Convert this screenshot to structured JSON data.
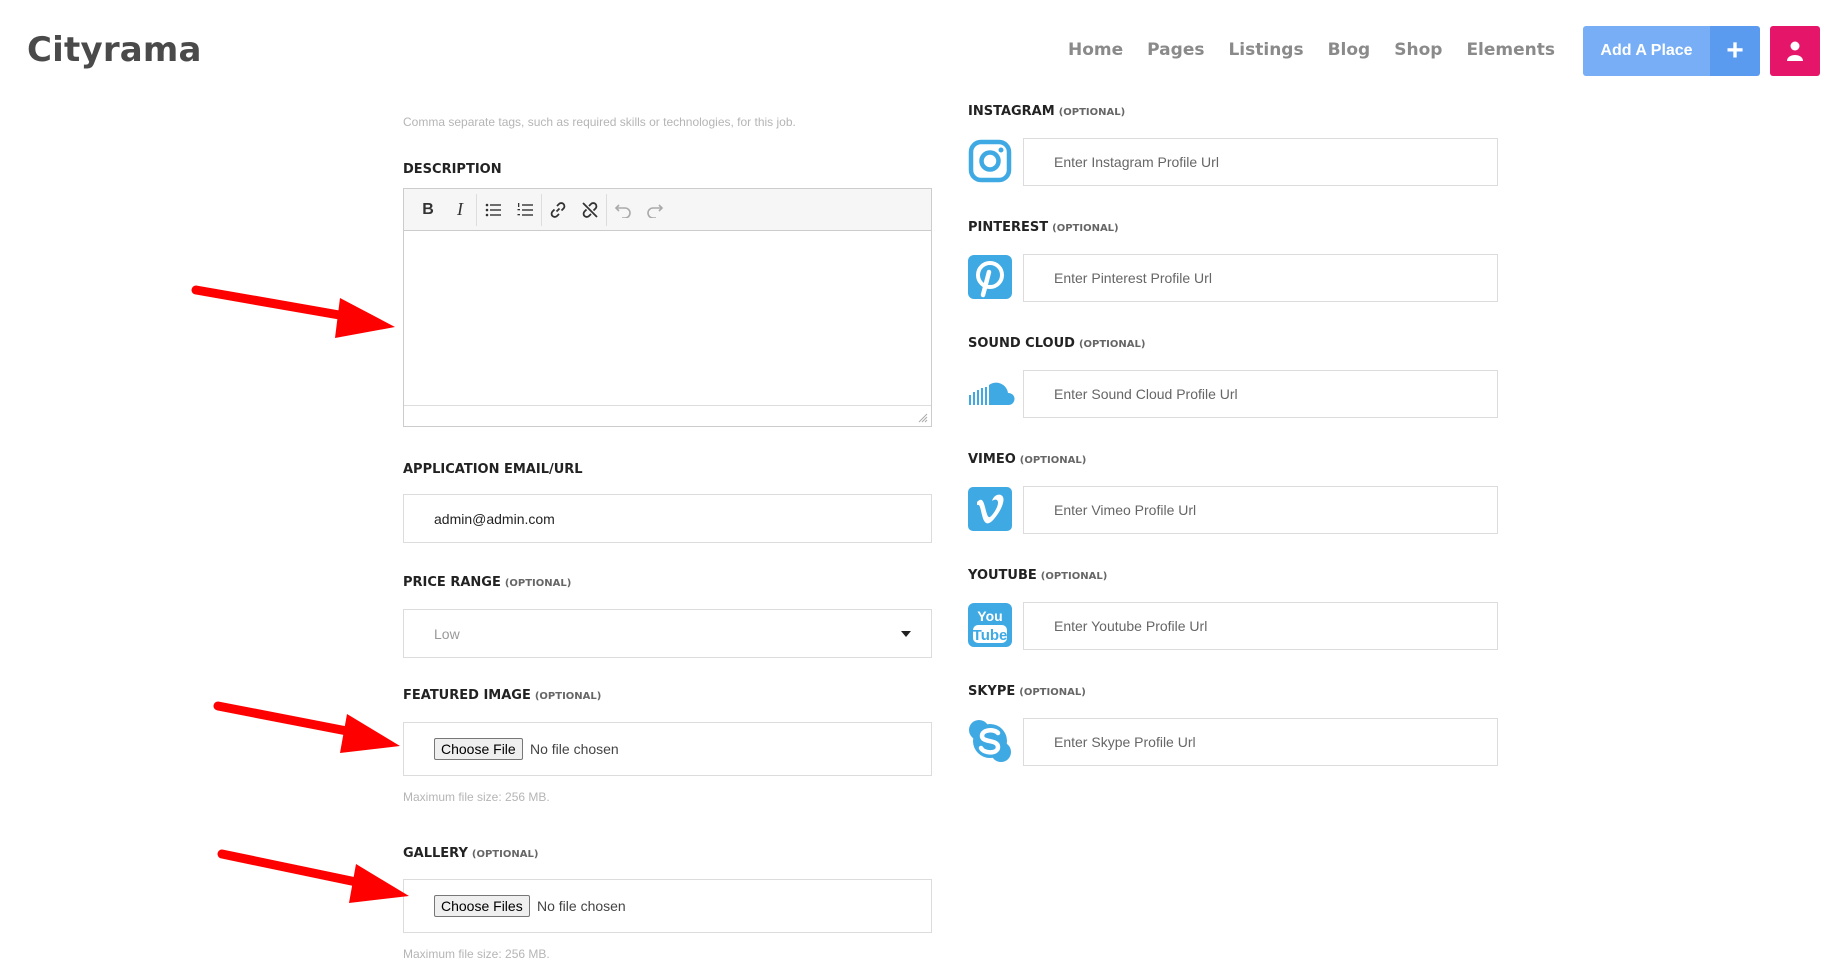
{
  "header": {
    "logo": "Cityrama",
    "nav": [
      "Home",
      "Pages",
      "Listings",
      "Blog",
      "Shop",
      "Elements"
    ],
    "add_place": "Add A Place",
    "plus": "+"
  },
  "form": {
    "tags_hint": "Comma separate tags, such as required skills or technologies, for this job.",
    "description_label": "DESCRIPTION",
    "email_label": "APPLICATION EMAIL/URL",
    "email_value": "admin@admin.com",
    "price_label": "PRICE RANGE",
    "price_value": "Low",
    "featured_label": "FEATURED IMAGE",
    "featured_button": "Choose File",
    "featured_status": "No file chosen",
    "featured_hint": "Maximum file size: 256 MB.",
    "gallery_label": "GALLERY",
    "gallery_button": "Choose Files",
    "gallery_status": "No file chosen",
    "gallery_hint": "Maximum file size: 256 MB.",
    "optional": "(OPTIONAL)"
  },
  "social": [
    {
      "label": "INSTAGRAM",
      "placeholder": "Enter Instagram Profile Url",
      "icon": "instagram-icon"
    },
    {
      "label": "PINTEREST",
      "placeholder": "Enter Pinterest Profile Url",
      "icon": "pinterest-icon"
    },
    {
      "label": "SOUND CLOUD",
      "placeholder": "Enter Sound Cloud Profile Url",
      "icon": "soundcloud-icon"
    },
    {
      "label": "VIMEO",
      "placeholder": "Enter Vimeo Profile Url",
      "icon": "vimeo-icon"
    },
    {
      "label": "YOUTUBE",
      "placeholder": "Enter Youtube Profile Url",
      "icon": "youtube-icon"
    },
    {
      "label": "SKYPE",
      "placeholder": "Enter Skype Profile Url",
      "icon": "skype-icon"
    }
  ],
  "colors": {
    "accent": "#78aef5",
    "accent_dark": "#5a9bf0",
    "user": "#e5166a",
    "social": "#3fa9e3",
    "arrow": "#ff0000"
  }
}
